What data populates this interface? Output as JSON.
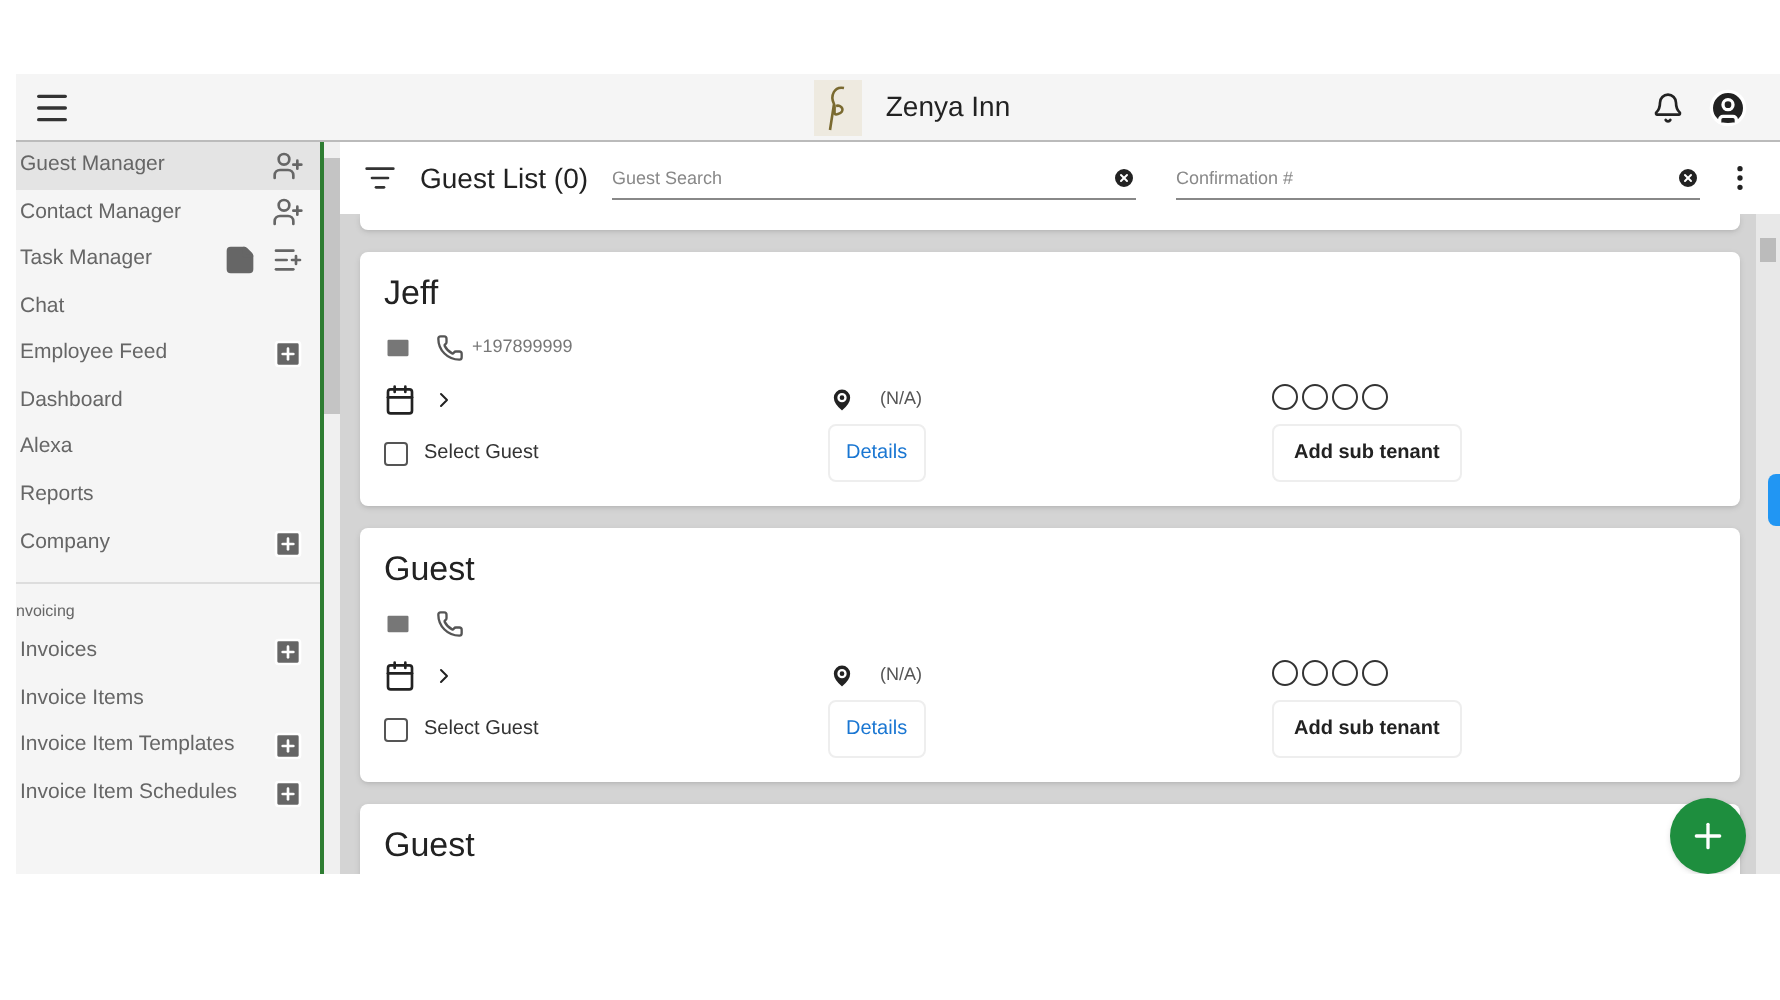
{
  "header": {
    "title": "Zenya Inn"
  },
  "sidebar": {
    "groups": [
      {
        "items": [
          {
            "label": "Guest Manager",
            "selected": true,
            "actions": [
              {
                "kind": "person-add"
              }
            ]
          },
          {
            "label": "Contact Manager",
            "selected": false,
            "actions": [
              {
                "kind": "person-add"
              }
            ]
          },
          {
            "label": "Task Manager",
            "selected": false,
            "actions": [
              {
                "kind": "note"
              },
              {
                "kind": "list-add"
              }
            ]
          },
          {
            "label": "Chat",
            "selected": false
          },
          {
            "label": "Employee Feed",
            "selected": false,
            "actions": [
              {
                "kind": "plus-box"
              }
            ]
          },
          {
            "label": "Dashboard",
            "selected": false
          },
          {
            "label": "Alexa",
            "selected": false
          },
          {
            "label": "Reports",
            "selected": false
          },
          {
            "label": "Company",
            "selected": false,
            "actions": [
              {
                "kind": "plus-box"
              }
            ]
          }
        ]
      },
      {
        "heading": "nvoicing",
        "items": [
          {
            "label": "Invoices",
            "selected": false,
            "actions": [
              {
                "kind": "plus-box"
              }
            ]
          },
          {
            "label": "Invoice Items",
            "selected": false
          },
          {
            "label": "Invoice Item Templates",
            "selected": false,
            "actions": [
              {
                "kind": "plus-box"
              }
            ]
          },
          {
            "label": "Invoice Item Schedules",
            "selected": false,
            "actions": [
              {
                "kind": "plus-box"
              }
            ]
          }
        ]
      }
    ]
  },
  "toolbar": {
    "title": "Guest List (0)",
    "search": {
      "placeholder": "Guest Search"
    },
    "confirmation": {
      "placeholder": "Confirmation #"
    }
  },
  "guests": [
    {
      "name": "Jeff",
      "phone": "+197899999",
      "location": "(N/A)",
      "stars": 0,
      "select_label": "Select Guest",
      "checked": false,
      "details": "Details",
      "add_sub": "Add sub tenant"
    },
    {
      "name": "Guest",
      "location": "(N/A)",
      "stars": 0,
      "select_label": "Select Guest",
      "checked": false,
      "details": "Details",
      "add_sub": "Add sub tenant"
    },
    {
      "name": "Guest"
    }
  ]
}
